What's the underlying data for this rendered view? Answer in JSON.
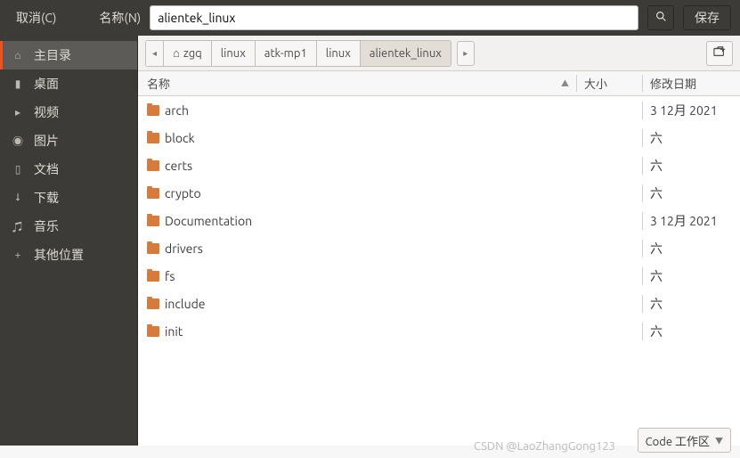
{
  "header": {
    "cancel": "取消(C)",
    "name_label": "名称(N)",
    "name_value": "alientek_linux",
    "save": "保存"
  },
  "sidebar": {
    "items": [
      {
        "icon": "⌂",
        "label": "主目录",
        "active": true
      },
      {
        "icon": "▮",
        "label": "桌面"
      },
      {
        "icon": "▸",
        "label": "视频"
      },
      {
        "icon": "◉",
        "label": "图片"
      },
      {
        "icon": "▯",
        "label": "文档"
      },
      {
        "icon": "⭣",
        "label": "下载"
      },
      {
        "icon": "♫",
        "label": "音乐"
      },
      {
        "icon": "+",
        "label": "其他位置"
      }
    ]
  },
  "breadcrumbs": {
    "items": [
      {
        "label": "zgq",
        "home": true
      },
      {
        "label": "linux"
      },
      {
        "label": "atk-mp1"
      },
      {
        "label": "linux"
      },
      {
        "label": "alientek_linux",
        "current": true
      }
    ]
  },
  "columns": {
    "name": "名称",
    "size": "大小",
    "date": "修改日期"
  },
  "files": [
    {
      "name": "arch",
      "size": "",
      "date": "3 12月 2021"
    },
    {
      "name": "block",
      "size": "",
      "date": "六"
    },
    {
      "name": "certs",
      "size": "",
      "date": "六"
    },
    {
      "name": "crypto",
      "size": "",
      "date": "六"
    },
    {
      "name": "Documentation",
      "size": "",
      "date": "3 12月 2021"
    },
    {
      "name": "drivers",
      "size": "",
      "date": "六"
    },
    {
      "name": "fs",
      "size": "",
      "date": "六"
    },
    {
      "name": "include",
      "size": "",
      "date": "六"
    },
    {
      "name": "init",
      "size": "",
      "date": "六"
    }
  ],
  "footer": {
    "filter": "Code 工作区"
  },
  "watermark": "CSDN @LaoZhangGong123"
}
